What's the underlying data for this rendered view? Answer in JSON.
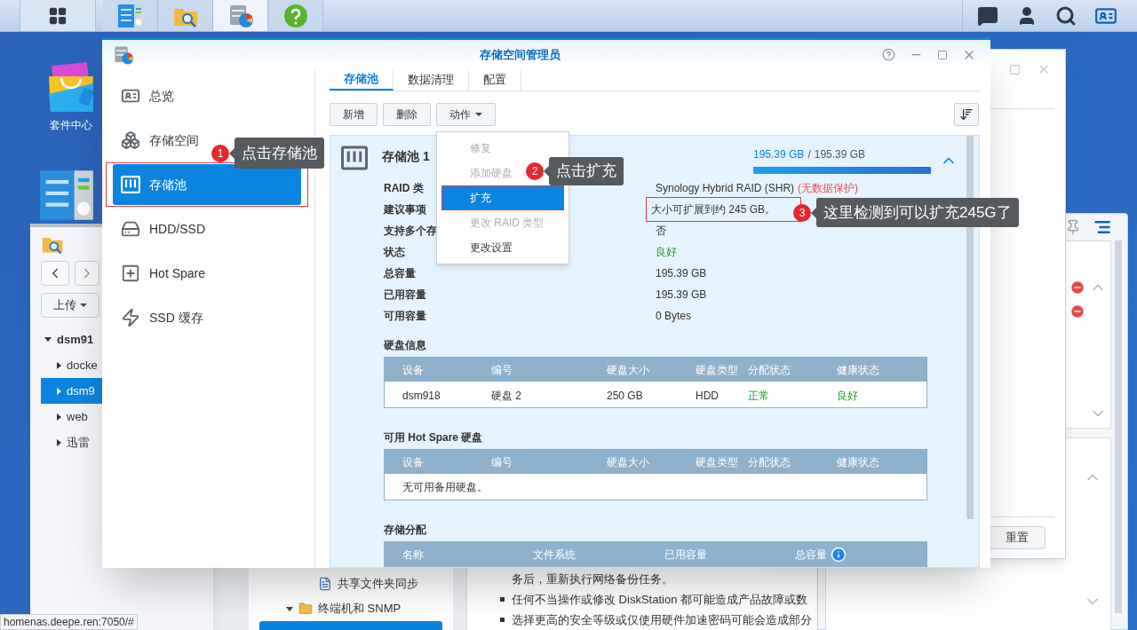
{
  "taskbar": {
    "apps": [
      {
        "kind": "panel",
        "selected": false
      },
      {
        "kind": "folder",
        "selected": false
      },
      {
        "kind": "storage",
        "selected": true
      },
      {
        "kind": "help",
        "selected": false
      }
    ]
  },
  "desktop_icons": [
    {
      "kind": "bag",
      "label": "套件中心"
    },
    {
      "kind": "panel"
    }
  ],
  "file_station": {
    "upload": "上传",
    "tree": [
      {
        "label": "dsm91",
        "expanded": true,
        "selected": false,
        "children": [
          {
            "label": "docke",
            "selected": false
          },
          {
            "label": "dsm9",
            "selected": true
          },
          {
            "label": "web",
            "selected": false
          },
          {
            "label": "迅雷",
            "selected": false
          }
        ]
      }
    ]
  },
  "control_panel": {
    "reset": "重置",
    "nav": [
      {
        "label": "共享文件夹同步",
        "kind": "item",
        "selected": false
      },
      {
        "label": "终端机和 SNMP",
        "kind": "group",
        "selected": false
      },
      {
        "kind": "item",
        "selected": true
      }
    ],
    "notes": [
      {
        "kind": "continuation",
        "text": "务后，重新执行网络备份任务。"
      },
      {
        "kind": "bullet",
        "text": "任何不当操作或修改 DiskStation 都可能造成产品故障或数"
      },
      {
        "kind": "bullet",
        "text": "选择更高的安全等级或仅使用硬件加速密码可能会造成部分"
      }
    ]
  },
  "main_window": {
    "title": "存储空间管理员",
    "nav": [
      {
        "label": "总览",
        "kind": "overview",
        "selected": false,
        "highlighted": false
      },
      {
        "label": "存储空间",
        "kind": "volume",
        "selected": false,
        "highlighted": false
      },
      {
        "label": "存储池",
        "kind": "pool",
        "selected": true,
        "highlighted": true
      },
      {
        "label": "HDD/SSD",
        "kind": "disk",
        "selected": false,
        "highlighted": false
      },
      {
        "label": "Hot Spare",
        "kind": "spare",
        "selected": false,
        "highlighted": false
      },
      {
        "label": "SSD 缓存",
        "kind": "cache",
        "selected": false,
        "highlighted": false
      }
    ],
    "tabs": [
      {
        "label": "存储池",
        "selected": true
      },
      {
        "label": "数据清理",
        "selected": false
      },
      {
        "label": "配置",
        "selected": false
      }
    ],
    "toolbar": [
      {
        "label": "新增",
        "dropdown": false
      },
      {
        "label": "删除",
        "dropdown": false
      },
      {
        "label": "动作",
        "dropdown": true
      }
    ],
    "action_menu": [
      {
        "label": "修复",
        "disabled": true,
        "selected": false
      },
      {
        "label": "添加硬盘",
        "disabled": true,
        "selected": false
      },
      {
        "label": "扩充",
        "disabled": false,
        "selected": true
      },
      {
        "label": "更改 RAID 类型",
        "disabled": true,
        "selected": false
      },
      {
        "label": "更改设置",
        "disabled": false,
        "selected": false
      }
    ],
    "pool": {
      "name": "存储池 1",
      "expanded": true,
      "usage": {
        "used": "195.39 GB",
        "separator": "/",
        "total": "195.39 GB",
        "level": 1
      },
      "properties": [
        {
          "label": "RAID 类",
          "value": "Synology Hybrid RAID (SHR)",
          "note": "(无数据保护)",
          "good": false,
          "highlighted": false
        },
        {
          "label": "建议事项",
          "value": "大小可扩展到约 245 GB。",
          "good": false,
          "highlighted": true
        },
        {
          "label": "支持多个存",
          "value": "否",
          "good": false,
          "highlighted": false
        },
        {
          "label": "状态",
          "value": "良好",
          "good": true,
          "highlighted": false
        },
        {
          "label": "总容量",
          "value": "195.39 GB",
          "good": false,
          "highlighted": false
        },
        {
          "label": "已用容量",
          "value": "195.39 GB",
          "good": false,
          "highlighted": false
        },
        {
          "label": "可用容量",
          "value": "0 Bytes",
          "good": false,
          "highlighted": false
        }
      ],
      "disk_info": {
        "title": "硬盘信息",
        "columns": [
          "设备",
          "编号",
          "硬盘大小",
          "硬盘类型",
          "分配状态",
          "健康状态"
        ],
        "rows": [
          [
            {
              "text": "dsm918",
              "good": false
            },
            {
              "text": "硬盘 2",
              "good": false
            },
            {
              "text": "250 GB",
              "good": false
            },
            {
              "text": "HDD",
              "good": false
            },
            {
              "text": "正常",
              "good": true
            },
            {
              "text": "良好",
              "good": true
            }
          ]
        ]
      },
      "hot_spare": {
        "title": "可用 Hot Spare 硬盘",
        "columns": [
          "设备",
          "编号",
          "硬盘大小",
          "硬盘类型",
          "分配状态",
          "健康状态"
        ],
        "empty": "无可用备用硬盘。"
      },
      "allocation": {
        "title": "存储分配",
        "columns": [
          "名称",
          "文件系统",
          "已用容量",
          "总容量"
        ]
      }
    }
  },
  "annotations": [
    {
      "number": "1",
      "text": "点击存储池"
    },
    {
      "number": "2",
      "text": "点击扩充"
    },
    {
      "number": "3",
      "text": "这里检测到可以扩充245G了"
    }
  ],
  "status_url": "homenas.deepe.ren:7050/#"
}
